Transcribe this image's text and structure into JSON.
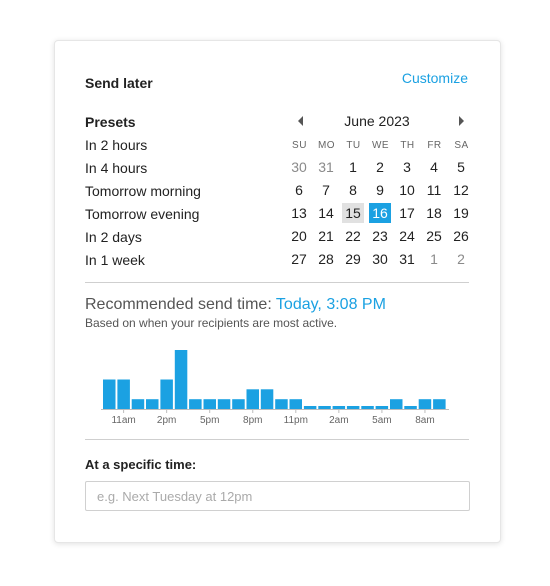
{
  "dialog": {
    "title": "Send later",
    "customize_label": "Customize"
  },
  "presets": {
    "heading": "Presets",
    "items": [
      "In 2 hours",
      "In 4 hours",
      "Tomorrow morning",
      "Tomorrow evening",
      "In 2 days",
      "In 1 week"
    ]
  },
  "calendar": {
    "month_label": "June 2023",
    "weekdays": [
      "SU",
      "MO",
      "TU",
      "WE",
      "TH",
      "FR",
      "SA"
    ],
    "weeks": [
      [
        "30",
        "31",
        "1",
        "2",
        "3",
        "4",
        "5"
      ],
      [
        "6",
        "7",
        "8",
        "9",
        "10",
        "11",
        "12"
      ],
      [
        "13",
        "14",
        "15",
        "16",
        "17",
        "18",
        "19"
      ],
      [
        "20",
        "21",
        "22",
        "23",
        "24",
        "25",
        "26"
      ],
      [
        "27",
        "28",
        "29",
        "30",
        "31",
        "1",
        "2"
      ]
    ],
    "other_month": [
      [
        0,
        0
      ],
      [
        0,
        1
      ],
      [
        4,
        5
      ],
      [
        4,
        6
      ]
    ],
    "today": [
      2,
      2
    ],
    "selected": [
      2,
      3
    ]
  },
  "recommendation": {
    "label": "Recommended send time:",
    "value": "Today, 3:08 PM",
    "subtitle": "Based on when  your recipients are most active."
  },
  "chart_data": {
    "type": "bar",
    "values": [
      30,
      30,
      10,
      10,
      30,
      60,
      10,
      10,
      10,
      10,
      20,
      20,
      10,
      10,
      3,
      3,
      3,
      3,
      3,
      3,
      10,
      3,
      10,
      10
    ],
    "tick_labels": [
      "11am",
      "2pm",
      "5pm",
      "8pm",
      "11pm",
      "2am",
      "5am",
      "8am"
    ],
    "tick_positions": [
      1,
      4,
      7,
      10,
      13,
      16,
      19,
      22
    ],
    "ylim": [
      0,
      60
    ],
    "grid": false,
    "color": "#1ba1e2"
  },
  "specific": {
    "label": "At a specific time:",
    "placeholder": "e.g. Next Tuesday at 12pm"
  },
  "colors": {
    "accent": "#1ba1e2"
  }
}
